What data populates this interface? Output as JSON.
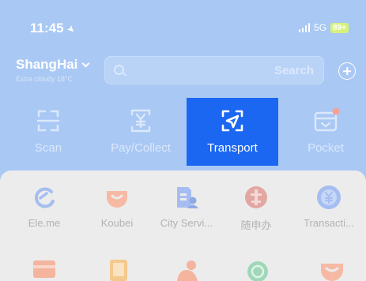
{
  "status_bar": {
    "time": "11:45",
    "network": "5G",
    "battery": "89+"
  },
  "header": {
    "city": "ShangHai",
    "weather": "Extra cloudy 18°C"
  },
  "search": {
    "button_label": "Search",
    "placeholder": ""
  },
  "actions": [
    {
      "label": "Scan",
      "icon": "scan-icon"
    },
    {
      "label": "Pay/Collect",
      "icon": "yuan-card-icon"
    },
    {
      "label": "Transport",
      "icon": "navigation-arrow-icon",
      "active": true
    },
    {
      "label": "Pocket",
      "icon": "wallet-icon"
    }
  ],
  "services": [
    {
      "label": "Ele.me",
      "icon": "eleme-icon",
      "color": "#a5bdf0"
    },
    {
      "label": "Koubei",
      "icon": "koubei-icon",
      "color": "#f6b9a4"
    },
    {
      "label": "City Servi...",
      "icon": "city-service-icon",
      "color": "#a5bdf0"
    },
    {
      "label": "随申办",
      "icon": "suishenban-icon",
      "color": "#e3a7a2"
    },
    {
      "label": "Transacti...",
      "icon": "transaction-icon",
      "color": "#a5bdf0"
    }
  ],
  "colors": {
    "header_bg": "#a9c8f4",
    "active_bg": "#1b67f2",
    "panel_bg": "#ececec"
  }
}
